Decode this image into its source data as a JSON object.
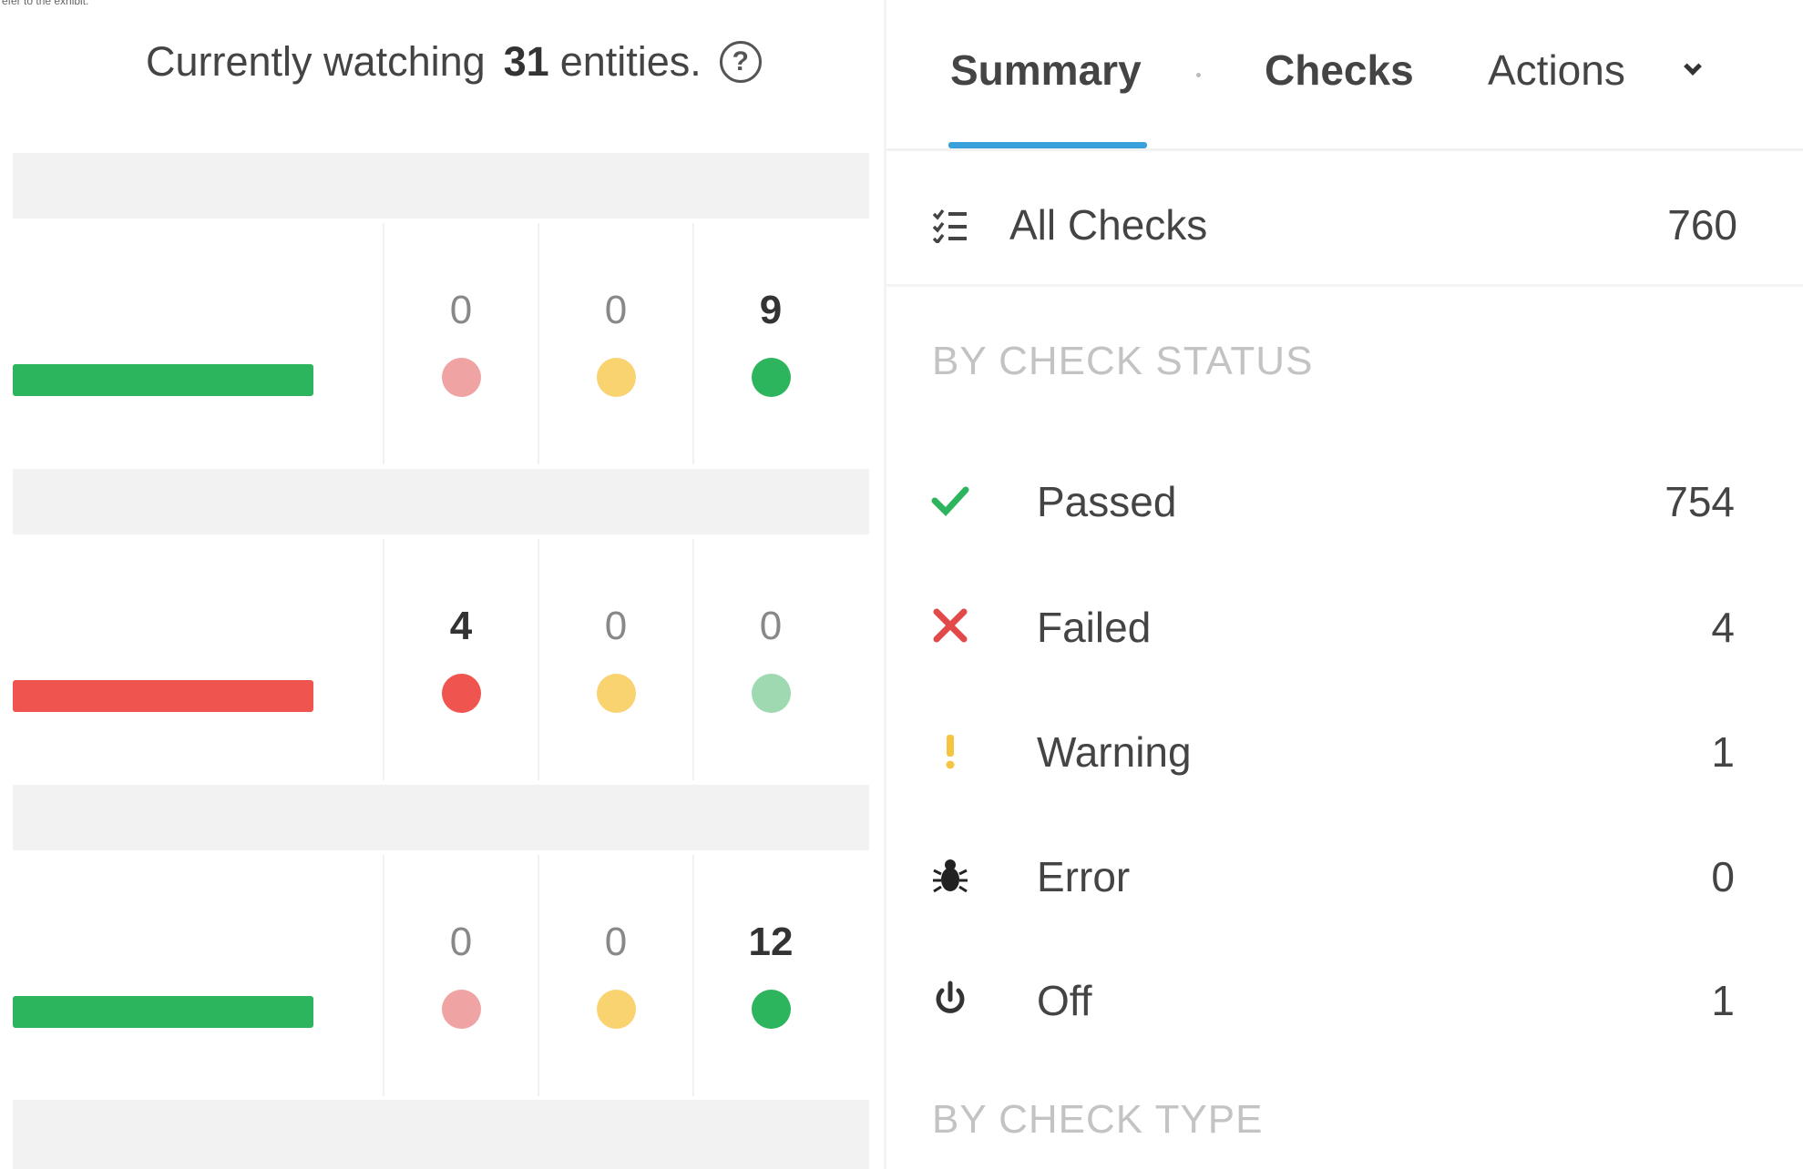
{
  "page": {
    "cropped_caption": "efer to the exhibit."
  },
  "watch_header": {
    "prefix": "Currently watching",
    "count": "31",
    "suffix": "entities.",
    "help_icon": "help-circle-icon"
  },
  "entity_rows": [
    {
      "health_color": "#2db55d",
      "counts": [
        "0",
        "0",
        "9"
      ],
      "bold": [
        false,
        false,
        true
      ],
      "dots": [
        "#f0a3a3",
        "#f9d36f",
        "#2db55d"
      ]
    },
    {
      "health_color": "#f0544f",
      "counts": [
        "4",
        "0",
        "0"
      ],
      "bold": [
        true,
        false,
        false
      ],
      "dots": [
        "#f0544f",
        "#f9d36f",
        "#9ed9b1"
      ]
    },
    {
      "health_color": "#2db55d",
      "counts": [
        "0",
        "0",
        "12"
      ],
      "bold": [
        false,
        false,
        true
      ],
      "dots": [
        "#f0a3a3",
        "#f9d36f",
        "#2db55d"
      ]
    }
  ],
  "tabs": {
    "summary": "Summary",
    "checks": "Checks",
    "actions": "Actions",
    "active": "summary",
    "accent_color": "#3aa0db"
  },
  "all_checks": {
    "icon": "list-icon",
    "label": "All Checks",
    "count": "760"
  },
  "by_check_status": {
    "title": "BY CHECK STATUS",
    "items": [
      {
        "icon": "check-icon",
        "label": "Passed",
        "count": "754",
        "color": "#2db55d"
      },
      {
        "icon": "cross-icon",
        "label": "Failed",
        "count": "4",
        "color": "#e24a4a"
      },
      {
        "icon": "exclamation-icon",
        "label": "Warning",
        "count": "1",
        "color": "#f5c542"
      },
      {
        "icon": "bug-icon",
        "label": "Error",
        "count": "0",
        "color": "#222222"
      },
      {
        "icon": "power-icon",
        "label": "Off",
        "count": "1",
        "color": "#333333"
      }
    ]
  },
  "by_check_type": {
    "title": "BY CHECK TYPE"
  }
}
